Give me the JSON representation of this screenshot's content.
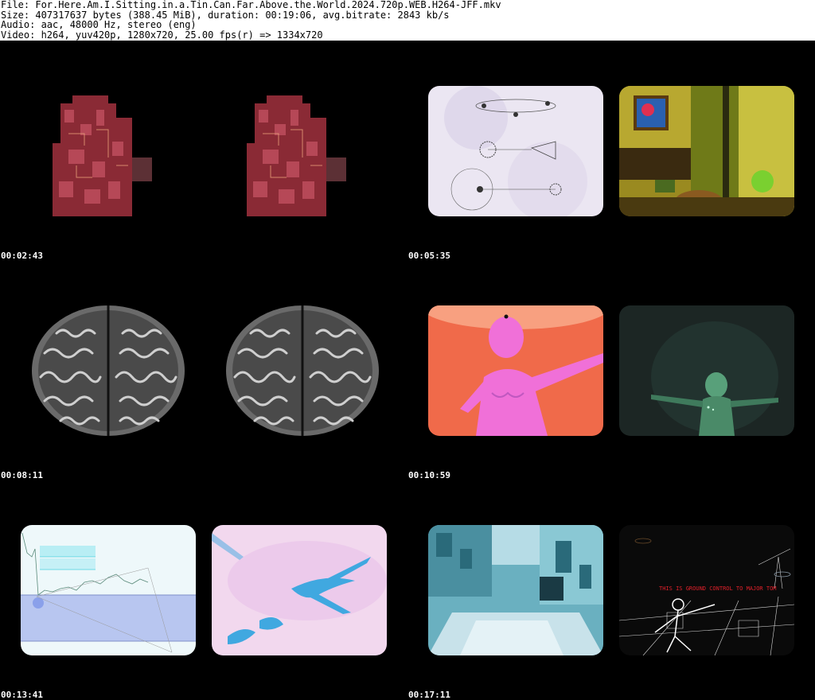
{
  "header": {
    "line1": "File: For.Here.Am.I.Sitting.in.a.Tin.Can.Far.Above.the.World.2024.720p.WEB.H264-JFF.mkv",
    "line2": "Size: 407317637 bytes (388.45 MiB), duration: 00:19:06, avg.bitrate: 2843 kb/s",
    "line3": "Audio: aac, 48000 Hz, stereo (eng)",
    "line4": "Video: h264, yuv420p, 1280x720, 25.00 fps(r) => 1334x720"
  },
  "timestamps": [
    "00:02:43",
    "00:05:35",
    "00:08:11",
    "00:10:59",
    "00:13:41",
    "00:17:11"
  ],
  "frames": [
    {
      "subject": "tower-collage"
    },
    {
      "subject": "tower-collage"
    },
    {
      "subject": "astronomy-diagram"
    },
    {
      "subject": "living-room"
    },
    {
      "subject": "brain-mri"
    },
    {
      "subject": "brain-mri"
    },
    {
      "subject": "inverted-figure"
    },
    {
      "subject": "green-figure"
    },
    {
      "subject": "price-chart"
    },
    {
      "subject": "ink-splash"
    },
    {
      "subject": "inverted-city"
    },
    {
      "subject": "line-art-city"
    }
  ],
  "overlay": {
    "caption": "THIS IS GROUND CONTROL TO MAJOR TOM"
  },
  "colors": {
    "background": "#000000",
    "header_bg": "#ffffff",
    "caption_red": "#e0202a"
  }
}
